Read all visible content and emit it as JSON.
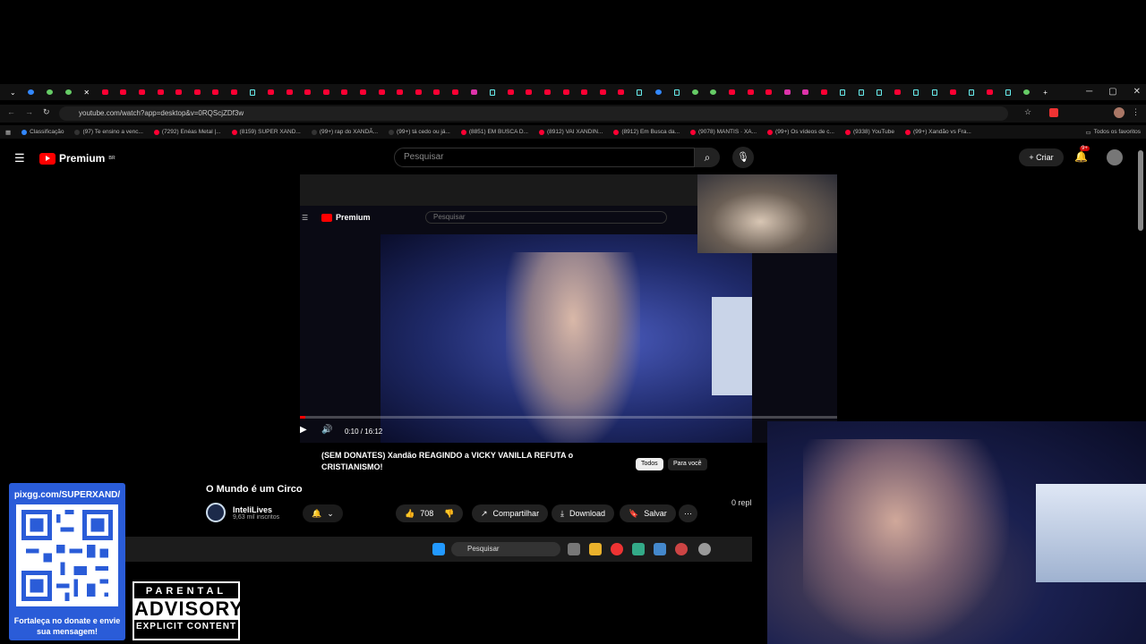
{
  "browser": {
    "url": "youtube.com/watch?app=desktop&v=0RQScjZDf3w",
    "bookmarks": [
      "Classificação",
      "(97) Te ensino a venc...",
      "(7292) Enéas Metal |...",
      "(8159) SUPER XAND...",
      "(99+) rap do XANDÃ...",
      "(99+) tá cedo ou já...",
      "(8851) EM BUSCA D...",
      "(8912) VAI XANDIN...",
      "(8912) Em Busca da...",
      "(9078) MANTIS · XA...",
      "(99+) Os vídeos de c...",
      "(9338) YouTube",
      "(99+) Xandão vs Fra..."
    ],
    "all_bookmarks": "Todos os favoritos"
  },
  "youtube": {
    "logo": "Premium",
    "region": "BR",
    "search_placeholder": "Pesquisar",
    "create_label": "Criar",
    "notification_count": "9+"
  },
  "inner_video": {
    "logo": "Premium",
    "search_placeholder": "Pesquisar",
    "time": "0:10 / 16:12",
    "progress": 0.01,
    "title": "(SEM DONATES) Xandão REAGINDO a VICKY VANILLA REFUTA o CRISTIANISMO!",
    "chips": [
      "Todos",
      "Para você"
    ]
  },
  "video": {
    "title": "O Mundo é um Circo",
    "channel": "InteliLives",
    "subscribers": "9,63 mil inscritos",
    "likes": "708",
    "share_label": "Compartilhar",
    "download_label": "Download",
    "save_label": "Salvar",
    "replies_label": "0 repl"
  },
  "taskbar": {
    "search_placeholder": "Pesquisar"
  },
  "donate": {
    "url": "pixgg.com/SUPERXAND/",
    "message": "Fortaleça no donate e envie sua mensagem!"
  },
  "advisory": {
    "line1": "PARENTAL",
    "line2": "ADVISORY",
    "line3": "EXPLICIT CONTENT"
  }
}
